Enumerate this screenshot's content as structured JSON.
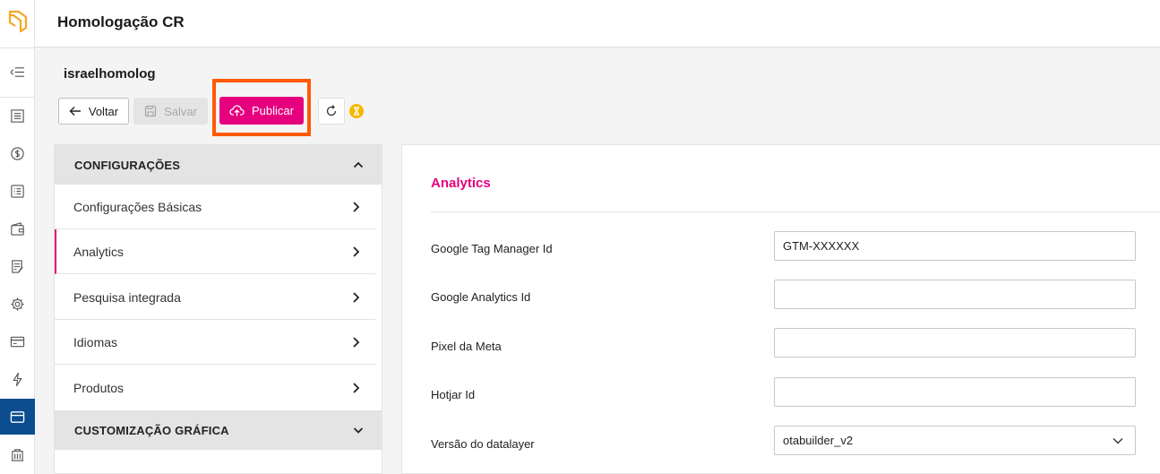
{
  "header": {
    "title": "Homologação CR"
  },
  "site": {
    "name": "israelhomolog"
  },
  "toolbar": {
    "back_label": "Voltar",
    "save_label": "Salvar",
    "publish_label": "Publicar"
  },
  "sidebar": {
    "groups": [
      {
        "label": "CONFIGURAÇÕES",
        "expanded": true,
        "items": [
          {
            "label": "Configurações Básicas"
          },
          {
            "label": "Analytics",
            "active": true
          },
          {
            "label": "Pesquisa integrada"
          },
          {
            "label": "Idiomas"
          },
          {
            "label": "Produtos"
          }
        ]
      },
      {
        "label": "CUSTOMIZAÇÃO GRÁFICA",
        "expanded": false
      }
    ]
  },
  "main": {
    "section_title": "Analytics",
    "fields": [
      {
        "label": "Google Tag Manager Id",
        "value": "GTM-XXXXXX"
      },
      {
        "label": "Google Analytics Id",
        "value": ""
      },
      {
        "label": "Pixel da Meta",
        "value": ""
      },
      {
        "label": "Hotjar Id",
        "value": ""
      },
      {
        "label": "Versão do datalayer",
        "value": "otabuilder_v2",
        "type": "select"
      }
    ]
  },
  "colors": {
    "accent": "#e6007e",
    "highlight": "#ff5a00",
    "rail_active": "#0b4d8f",
    "pending": "#f5b800"
  },
  "icons": {
    "rail": [
      "logo-icon",
      "collapse-menu-icon",
      "catalog-icon",
      "dollar-icon",
      "list-icon",
      "wallet-icon",
      "document-icon",
      "gear-icon",
      "card-icon",
      "lightning-icon",
      "website-icon",
      "building-icon"
    ]
  }
}
